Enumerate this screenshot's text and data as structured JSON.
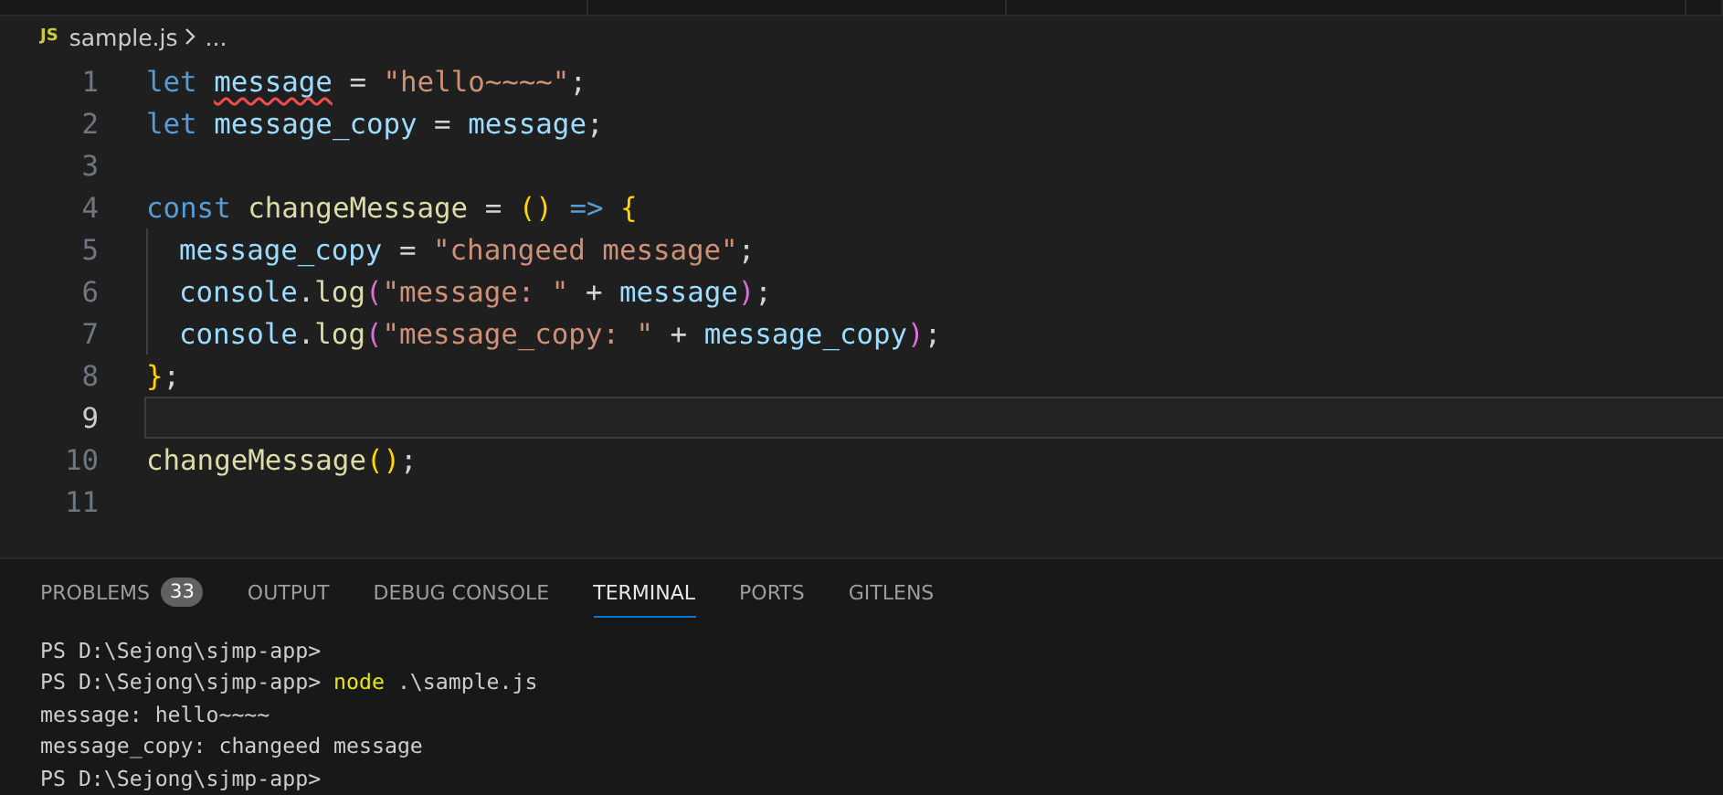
{
  "breadcrumb": {
    "file_badge": "JS",
    "file": "sample.js",
    "rest": "..."
  },
  "editor": {
    "lines": [
      {
        "number": "1",
        "current": false,
        "indent": false,
        "tokens": [
          {
            "kind": "keyword",
            "text": "let "
          },
          {
            "kind": "variable",
            "text": "message",
            "error": true
          },
          {
            "kind": "plain",
            "text": " = "
          },
          {
            "kind": "string",
            "text": "\"hello~~~~\""
          },
          {
            "kind": "plain",
            "text": ";"
          }
        ]
      },
      {
        "number": "2",
        "current": false,
        "indent": false,
        "tokens": [
          {
            "kind": "keyword",
            "text": "let "
          },
          {
            "kind": "variable",
            "text": "message_copy"
          },
          {
            "kind": "plain",
            "text": " = "
          },
          {
            "kind": "variable",
            "text": "message"
          },
          {
            "kind": "plain",
            "text": ";"
          }
        ]
      },
      {
        "number": "3",
        "current": false,
        "indent": false
      },
      {
        "number": "4",
        "current": false,
        "indent": false,
        "tokens": [
          {
            "kind": "keyword",
            "text": "const "
          },
          {
            "kind": "function",
            "text": "changeMessage"
          },
          {
            "kind": "plain",
            "text": " = "
          },
          {
            "kind": "bracket1",
            "text": "() "
          },
          {
            "kind": "keyword",
            "text": "=> "
          },
          {
            "kind": "bracket1",
            "text": "{"
          }
        ]
      },
      {
        "number": "5",
        "current": false,
        "indent": true,
        "tokens": [
          {
            "kind": "variable",
            "text": "message_copy"
          },
          {
            "kind": "plain",
            "text": " = "
          },
          {
            "kind": "string",
            "text": "\"changeed message\""
          },
          {
            "kind": "plain",
            "text": ";"
          }
        ]
      },
      {
        "number": "6",
        "current": false,
        "indent": true,
        "tokens": [
          {
            "kind": "variable",
            "text": "console"
          },
          {
            "kind": "plain",
            "text": "."
          },
          {
            "kind": "function",
            "text": "log"
          },
          {
            "kind": "bracket2",
            "text": "("
          },
          {
            "kind": "string",
            "text": "\"message: \""
          },
          {
            "kind": "plain",
            "text": " + "
          },
          {
            "kind": "variable",
            "text": "message"
          },
          {
            "kind": "bracket2",
            "text": ")"
          },
          {
            "kind": "plain",
            "text": ";"
          }
        ]
      },
      {
        "number": "7",
        "current": false,
        "indent": true,
        "tokens": [
          {
            "kind": "variable",
            "text": "console"
          },
          {
            "kind": "plain",
            "text": "."
          },
          {
            "kind": "function",
            "text": "log"
          },
          {
            "kind": "bracket2",
            "text": "("
          },
          {
            "kind": "string",
            "text": "\"message_copy: \""
          },
          {
            "kind": "plain",
            "text": " + "
          },
          {
            "kind": "variable",
            "text": "message_copy"
          },
          {
            "kind": "bracket2",
            "text": ")"
          },
          {
            "kind": "plain",
            "text": ";"
          }
        ]
      },
      {
        "number": "8",
        "current": false,
        "indent": false,
        "tokens": [
          {
            "kind": "bracket1",
            "text": "}"
          },
          {
            "kind": "plain",
            "text": ";"
          }
        ]
      },
      {
        "number": "9",
        "current": true,
        "indent": false
      },
      {
        "number": "10",
        "current": false,
        "indent": false,
        "tokens": [
          {
            "kind": "function",
            "text": "changeMessage"
          },
          {
            "kind": "bracket1",
            "text": "()"
          },
          {
            "kind": "plain",
            "text": ";"
          }
        ]
      },
      {
        "number": "11",
        "current": false,
        "indent": false
      }
    ]
  },
  "panel": {
    "tabs": [
      {
        "label": "PROBLEMS",
        "badge": "33",
        "selected": false
      },
      {
        "label": "OUTPUT",
        "selected": false
      },
      {
        "label": "DEBUG CONSOLE",
        "selected": false
      },
      {
        "label": "TERMINAL",
        "selected": true
      },
      {
        "label": "PORTS",
        "selected": false
      },
      {
        "label": "GITLENS",
        "selected": false
      }
    ],
    "terminal": [
      [
        {
          "kind": "output",
          "text": "PS D:\\Sejong\\sjmp-app>"
        }
      ],
      [
        {
          "kind": "output",
          "text": "PS D:\\Sejong\\sjmp-app> "
        },
        {
          "kind": "command",
          "text": "node"
        },
        {
          "kind": "output",
          "text": " .\\sample.js"
        }
      ],
      [
        {
          "kind": "output",
          "text": "message: hello~~~~"
        }
      ],
      [
        {
          "kind": "output",
          "text": "message_copy: changeed message"
        }
      ],
      [
        {
          "kind": "output",
          "text": "PS D:\\Sejong\\sjmp-app>"
        }
      ]
    ]
  }
}
